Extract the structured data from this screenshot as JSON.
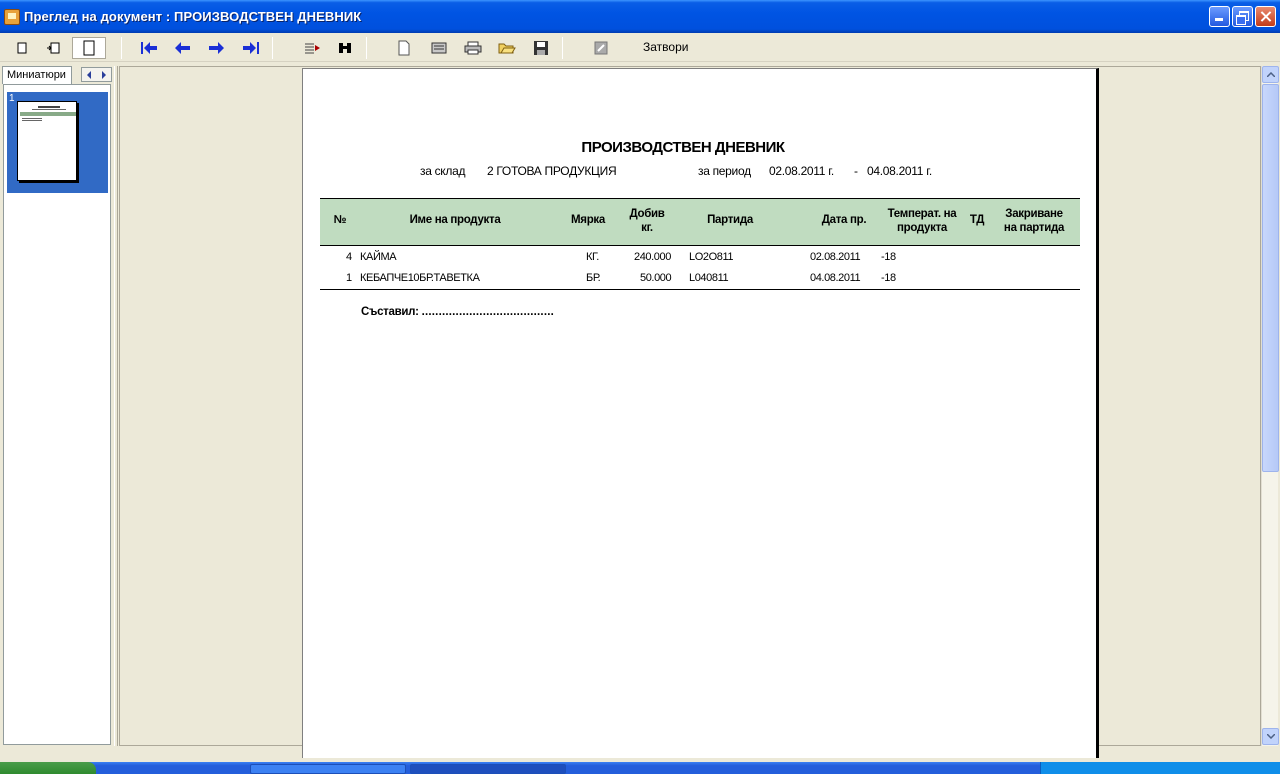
{
  "window": {
    "title": "Преглед на документ : ПРОИЗВОДСТВЕН ДНЕВНИК"
  },
  "toolbar": {
    "close_label": "Затвори",
    "icons": [
      "single-page-icon",
      "fit-width-icon",
      "fit-page-icon",
      "first-page-icon",
      "prev-page-icon",
      "next-page-icon",
      "last-page-icon",
      "export-icon",
      "find-icon",
      "new-page-icon",
      "page-setup-icon",
      "print-icon",
      "open-icon",
      "save-icon",
      "edit-icon"
    ]
  },
  "thumbnails": {
    "tab_label": "Миниатюри",
    "items": [
      {
        "number": "1"
      }
    ]
  },
  "report": {
    "title": "ПРОИЗВОДСТВЕН ДНЕВНИК",
    "warehouse_prefix": "за склад",
    "warehouse": "2 ГОТОВА ПРОДУКЦИЯ",
    "period_prefix": "за период",
    "period_from": "02.08.2011 г.",
    "period_sep": "-",
    "period_to": "04.08.2011 г.",
    "columns": {
      "no": "№",
      "product": "Име на продукта",
      "unit": "Мярка",
      "yield_l1": "Добив",
      "yield_l2": "кг.",
      "batch": "Партида",
      "date": "Дата пр.",
      "temp_l1": "Температ. на",
      "temp_l2": "продукта",
      "td": "ТД",
      "close_l1": "Закриване",
      "close_l2": "на партида"
    },
    "rows": [
      {
        "no": "4",
        "product": "КАЙМА",
        "unit": "КГ.",
        "yield": "240.000",
        "batch": "LO2O811",
        "date": "02.08.2011",
        "temp": "-18"
      },
      {
        "no": "1",
        "product": "КЕБАПЧЕ10БР.ТАВЕТКА",
        "unit": "БР.",
        "yield": "50.000",
        "batch": "L040811",
        "date": "04.08.2011",
        "temp": "-18"
      }
    ],
    "signed_label": "Съставил:",
    "signed_dots": "......................................."
  },
  "colors": {
    "titlebar": "#0054e3",
    "table_header": "#c0dcc0",
    "toolbar_arrows": "#1a2fd6",
    "selection": "#316ac5"
  }
}
